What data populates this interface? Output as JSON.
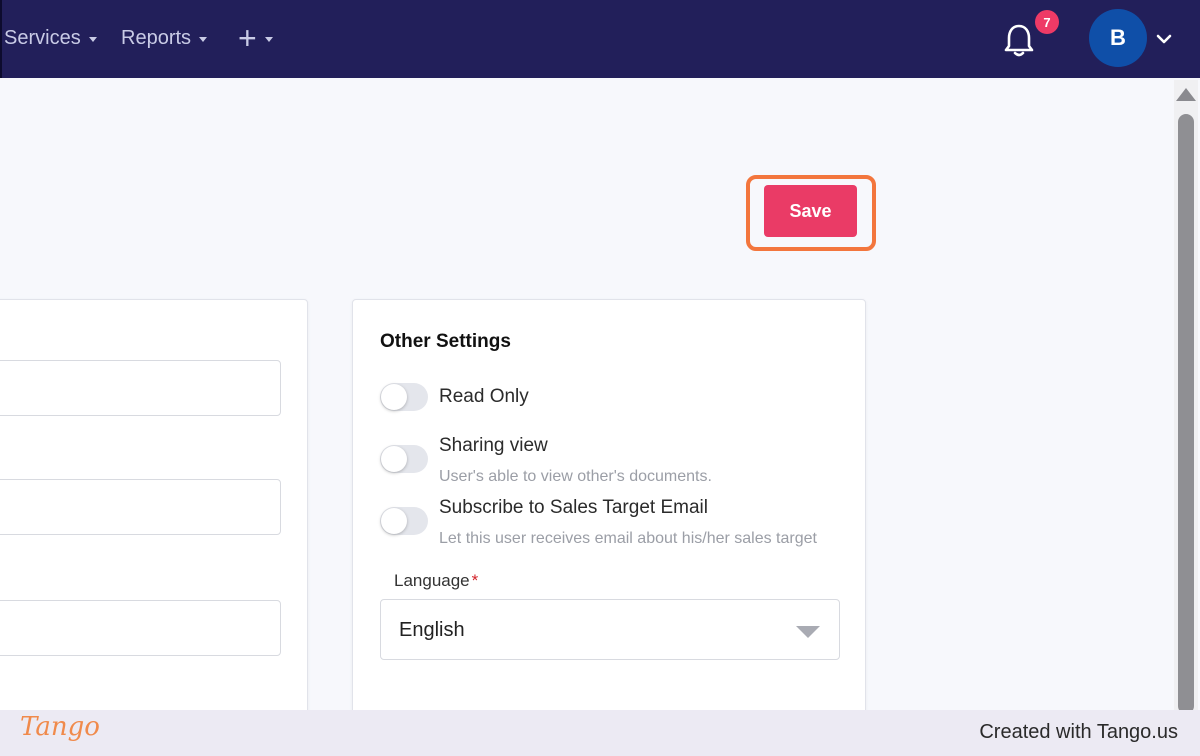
{
  "nav": {
    "items": [
      {
        "label": "Services"
      },
      {
        "label": "Reports"
      }
    ],
    "plus_symbol": "+",
    "notification_count": "7",
    "avatar_initial": "B"
  },
  "toolbar": {
    "save_label": "Save"
  },
  "other_settings": {
    "title": "Other Settings",
    "options": [
      {
        "label": "Read Only",
        "description": "",
        "enabled": false
      },
      {
        "label": "Sharing view",
        "description": "User's able to view other's documents.",
        "enabled": false
      },
      {
        "label": "Subscribe to Sales Target Email",
        "description": "Let this user receives email about his/her sales target",
        "enabled": false
      }
    ],
    "language": {
      "label": "Language",
      "required_mark": "*",
      "value": "English"
    }
  },
  "footer": {
    "logo_text": "Tango",
    "created_text": "Created with Tango.us"
  },
  "colors": {
    "nav_bg": "#221f5a",
    "save_bg": "#ea3b66",
    "highlight": "#f3763d",
    "badge": "#ee3a66",
    "avatar": "#0f4fa8"
  }
}
